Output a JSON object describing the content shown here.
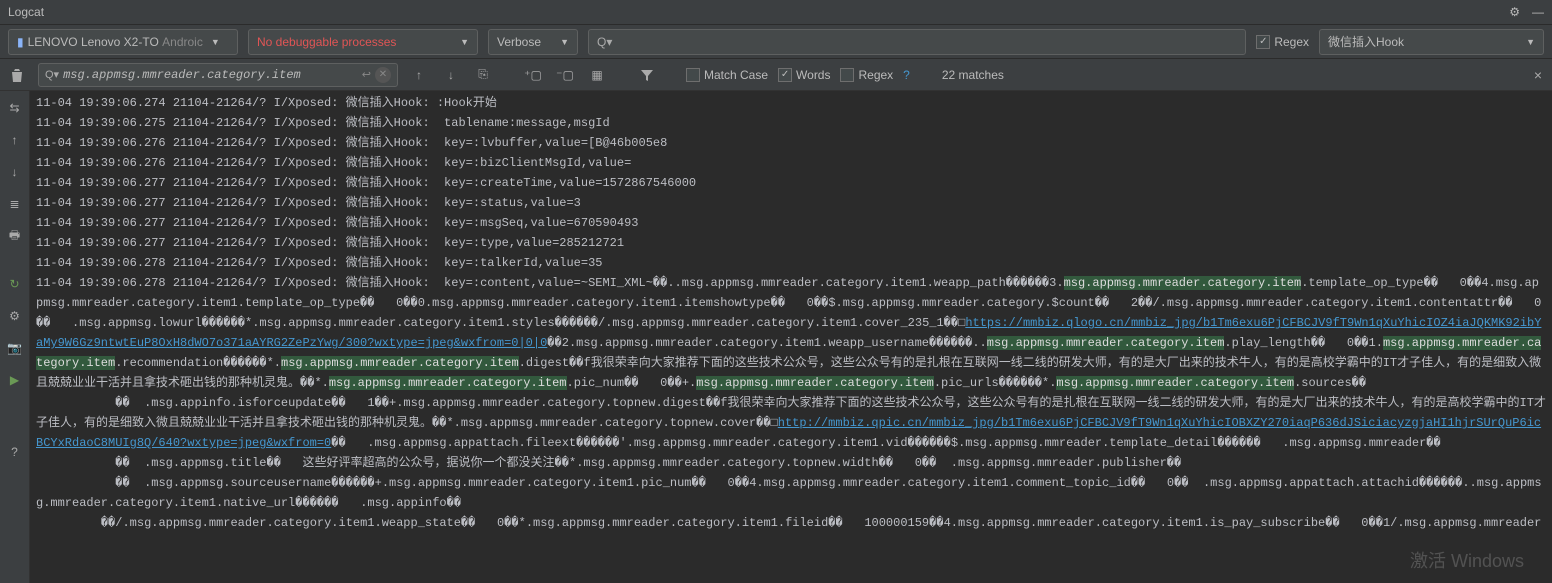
{
  "titlebar": {
    "title": "Logcat"
  },
  "toolbar": {
    "device": {
      "icon": "📱",
      "name": "LENOVO Lenovo X2-TO",
      "os": "Androic"
    },
    "process": "No debuggable processes",
    "level": "Verbose",
    "search_placeholder": "Q▾",
    "regex_label": "Regex",
    "filter": "微信插入Hook"
  },
  "findbar": {
    "query": "msg.appmsg.mmreader.category.item",
    "match_case": "Match Case",
    "words": "Words",
    "regex": "Regex",
    "matches": "22 matches"
  },
  "log": {
    "lines": [
      "11-04 19:39:06.274 21104-21264/? I/Xposed: 微信插入Hook: :Hook开始",
      "11-04 19:39:06.275 21104-21264/? I/Xposed: 微信插入Hook:  tablename:message,msgId",
      "11-04 19:39:06.276 21104-21264/? I/Xposed: 微信插入Hook:  key=:lvbuffer,value=[B@46b005e8",
      "11-04 19:39:06.276 21104-21264/? I/Xposed: 微信插入Hook:  key=:bizClientMsgId,value=",
      "11-04 19:39:06.277 21104-21264/? I/Xposed: 微信插入Hook:  key=:createTime,value=1572867546000",
      "11-04 19:39:06.277 21104-21264/? I/Xposed: 微信插入Hook:  key=:status,value=3",
      "11-04 19:39:06.277 21104-21264/? I/Xposed: 微信插入Hook:  key=:msgSeq,value=670590493",
      "11-04 19:39:06.277 21104-21264/? I/Xposed: 微信插入Hook:  key=:type,value=285212721",
      "11-04 19:39:06.278 21104-21264/? I/Xposed: 微信插入Hook:  key=:talkerId,value=35"
    ],
    "longline_prefix": "11-04 19:39:06.278 21104-21264/? I/Xposed: 微信插入Hook:  key=:content,value=~SEMI_XML~��..msg.appmsg.mmreader.category.item1.weapp_path������3.",
    "hl_token": "msg.appmsg.mmreader.category.item",
    "seg_a": ".template_op_type��   0��4.msg.appmsg.mmreader.category.item1.template_op_type��   0��0.msg.appmsg.mmreader.category.item1.itemshowtype��   0��$.msg.appmsg.mmreader.category.$count��   2��/.msg.appmsg.mmreader.category.item1.contentattr��   0��   .msg.appmsg.lowurl������*.msg.appmsg.mmreader.category.item1.styles������/.msg.appmsg.mmreader.category.item1.cover_235_1��□",
    "link1": "https://mmbiz.qlogo.cn/mmbiz_jpg/b1Tm6exu6PjCFBCJV9fT9Wn1qXuYhicIOZ4iaJQKMK92ibYaMy9W6Gz9ntwtEuP8OxH8dWO7o371aAYRG2ZePzYwg/300?wxtype=jpeg&wxfrom=0|0|0",
    "seg_b": "��2.msg.appmsg.mmreader.category.item1.weapp_username������..",
    "seg_c": ".play_length��   0��1.",
    "seg_d": ".recommendation������*.",
    "seg_e": ".digest��f我很荣幸向大家推荐下面的这些技术公众号，这些公众号有的是扎根在互联网一线二线的研发大师，有的是大厂出来的技术牛人，有的是高校学霸中的IT才子佳人，有的是细致入微且兢兢业业干活并且拿技术砸出钱的那种机灵鬼。��*.",
    "seg_f": ".pic_num��   0��+.",
    "seg_g": ".pic_urls������*.",
    "seg_h": ".sources��",
    "para2_a": "           ��  .msg.appinfo.isforceupdate��   1��+.msg.appmsg.mmreader.category.topnew.digest��f我很荣幸向大家推荐下面的这些技术公众号，这些公众号有的是扎根在互联网一线二线的研发大师，有的是大厂出来的技术牛人，有的是高校学霸中的IT才子佳人，有的是细致入微且兢兢业业干活并且拿技术砸出钱的那种机灵鬼。��*.msg.appmsg.mmreader.category.topnew.cover��□",
    "link2": "http://mmbiz.qpic.cn/mmbiz_jpg/b1Tm6exu6PjCFBCJV9fT9Wn1qXuYhicIOBXZY270iaqP636dJSiciacyzgjaHI1hjrSUrQuP6icBCYxRdaoC8MUIg8Q/640?wxtype=jpeg&wxfrom=0",
    "para2_b": "��   .msg.appmsg.appattach.fileext������'.msg.appmsg.mmreader.category.item1.vid������$.msg.appmsg.mmreader.template_detail������   .msg.appmsg.mmreader��",
    "para3": "           ��  .msg.appmsg.title��   这些好评率超高的公众号，据说你一个都没关注��*.msg.appmsg.mmreader.category.topnew.width��   0��  .msg.appmsg.mmreader.publisher��",
    "para4": "           ��  .msg.appmsg.sourceusername������+.msg.appmsg.mmreader.category.item1.pic_num��   0��4.msg.appmsg.mmreader.category.item1.comment_topic_id��   0��  .msg.appmsg.appattach.attachid������..msg.appmsg.mmreader.category.item1.native_url������   .msg.appinfo��",
    "para5": "         ��/.msg.appmsg.mmreader.category.item1.weapp_state��   0��*.msg.appmsg.mmreader.category.item1.fileid��   100000159��4.msg.appmsg.mmreader.category.item1.is_pay_subscribe��   0��1/.msg.appmsg.mmreader"
  },
  "watermark": "激活 Windows"
}
